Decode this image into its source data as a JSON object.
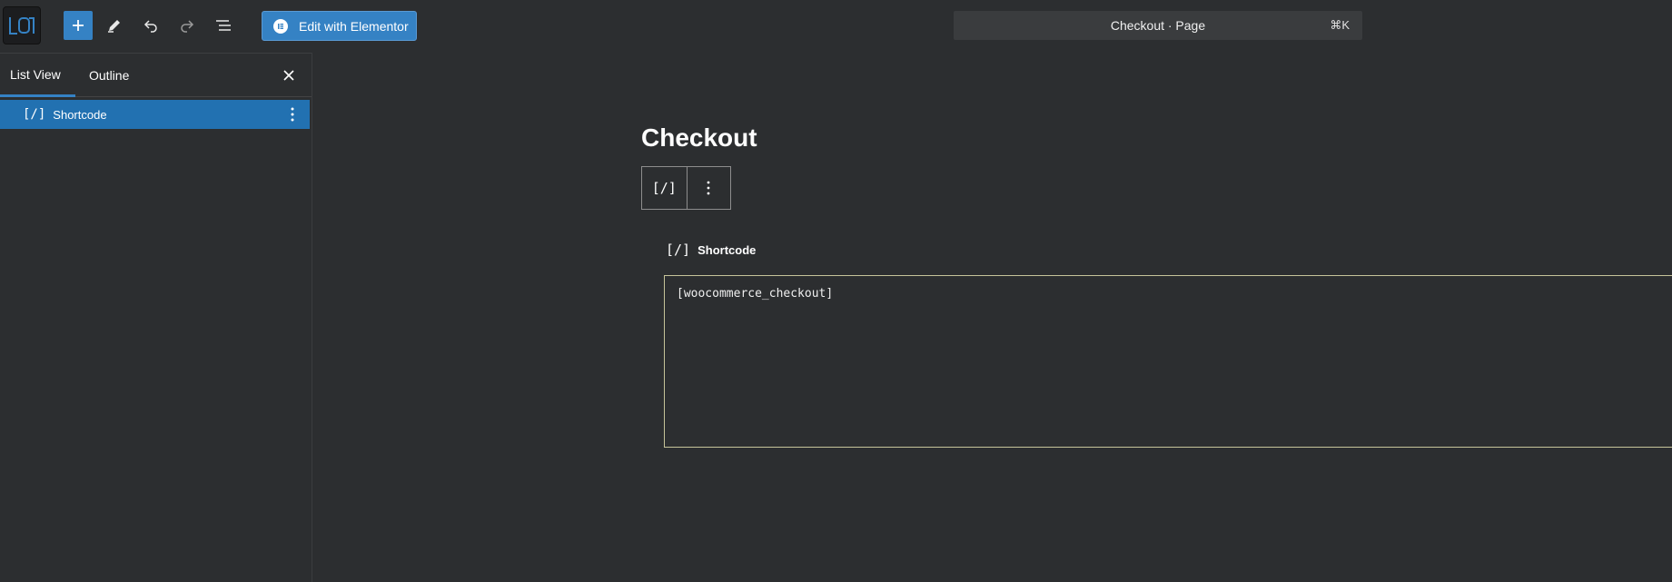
{
  "toolbar": {
    "add_icon": "plus-icon",
    "edit_icon": "pencil-icon",
    "undo_icon": "undo-icon",
    "redo_icon": "redo-icon",
    "document_overview_icon": "list-view-icon",
    "elementor_button_label": "Edit with Elementor",
    "command": {
      "title": "Checkout · Page",
      "shortcut": "⌘K"
    }
  },
  "left_panel": {
    "tabs": [
      {
        "label": "List View",
        "active": true
      },
      {
        "label": "Outline",
        "active": false
      }
    ],
    "items": [
      {
        "icon": "[/]",
        "label": "Shortcode",
        "selected": true
      }
    ]
  },
  "canvas": {
    "page_title": "Checkout",
    "block_toolbar": {
      "block_icon": "[/]"
    },
    "block": {
      "icon": "[/]",
      "label": "Shortcode",
      "value": "[woocommerce_checkout]"
    }
  },
  "colors": {
    "background": "#2c2e30",
    "accent": "#3582c4",
    "selected_row": "#2271b1",
    "shortcode_border": "#c6c49a"
  }
}
